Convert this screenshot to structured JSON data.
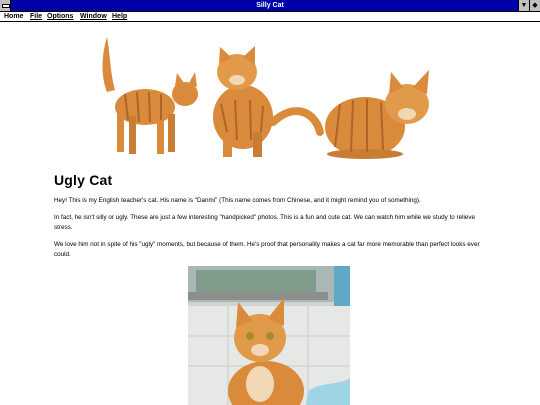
{
  "window": {
    "title": "Silly Cat",
    "minimize_glyph": "▼",
    "maximize_glyph": "◆"
  },
  "menu": {
    "items": [
      {
        "label": "Home"
      },
      {
        "label": "File"
      },
      {
        "label": "Options"
      },
      {
        "label": "Window"
      },
      {
        "label": "Help"
      }
    ]
  },
  "page": {
    "heading": "Ugly Cat",
    "paragraphs": [
      "Hey! This is my English teacher's cat. His name is \"Danmi\" (This name comes from Chinese, and it might remind you of something).",
      "In fact, he isn't silly or ugly. These are just a few interesting \"handpicked\" photos. This is a fun and cute cat. We can watch him while we study to relieve stress.",
      "We love him not in spite of his \"ugly\" moments, but because of them. He's proof that personality makes a cat far more memorable than perfect looks ever could."
    ]
  },
  "colors": {
    "titlebar": "#0000a8",
    "cat_orange": "#d98a3a",
    "cat_stripe": "#b0642a"
  }
}
